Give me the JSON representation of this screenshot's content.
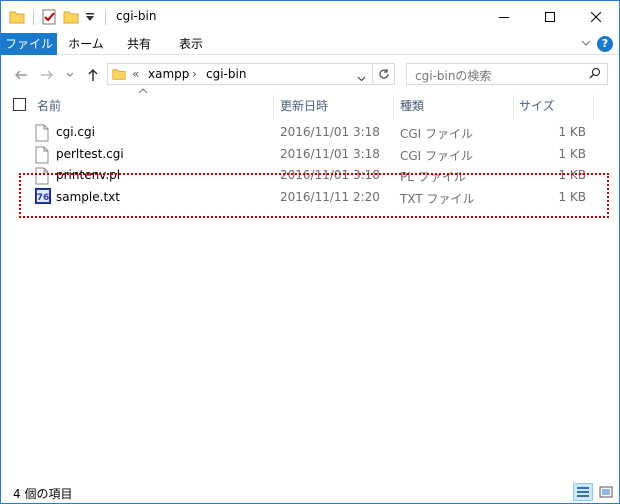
{
  "window": {
    "title": "cgi-bin"
  },
  "titlebar": {
    "minimize_icon": "minimize-icon",
    "maximize_icon": "maximize-icon",
    "close_icon": "close-icon"
  },
  "ribbon": {
    "tabs": [
      {
        "label": "ファイル"
      },
      {
        "label": "ホーム"
      },
      {
        "label": "共有"
      },
      {
        "label": "表示"
      }
    ]
  },
  "navigation": {
    "breadcrumb": {
      "overflow": "«",
      "items": [
        "xampp",
        "cgi-bin"
      ],
      "separator": "›"
    },
    "search": {
      "placeholder": "cgi-binの検索"
    }
  },
  "columns": {
    "name": "名前",
    "date": "更新日時",
    "type": "種類",
    "size": "サイズ"
  },
  "files": [
    {
      "name": "cgi.cgi",
      "date": "2016/11/01 3:18",
      "type": "CGI ファイル",
      "size": "1 KB",
      "icon": "document-icon"
    },
    {
      "name": "perltest.cgi",
      "date": "2016/11/01 3:18",
      "type": "CGI ファイル",
      "size": "1 KB",
      "icon": "document-icon"
    },
    {
      "name": "printenv.pl",
      "date": "2016/11/01 3:18",
      "type": "PL ファイル",
      "size": "1 KB",
      "icon": "document-icon"
    },
    {
      "name": "sample.txt",
      "date": "2016/11/11 2:20",
      "type": "TXT ファイル",
      "size": "1 KB",
      "icon": "text-editor-icon"
    }
  ],
  "status": {
    "item_count": "4 個の項目"
  },
  "colors": {
    "accent": "#1979ca",
    "highlight_border": "#c00000"
  }
}
